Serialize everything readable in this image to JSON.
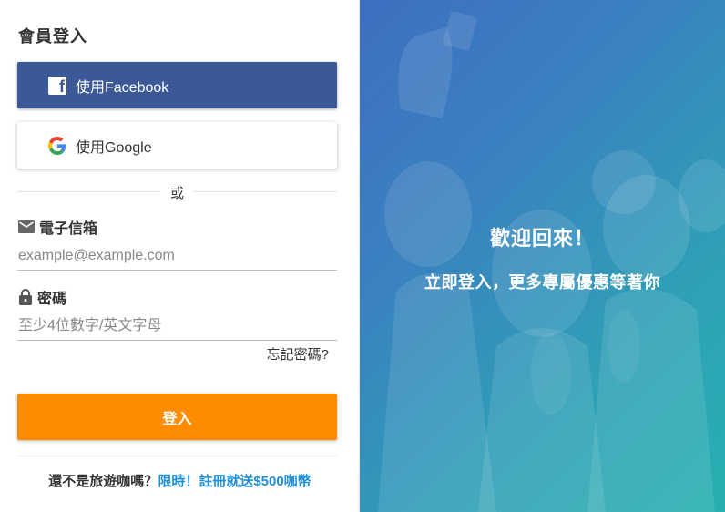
{
  "login": {
    "title": "會員登入",
    "facebook_label": "使用Facebook",
    "google_label": "使用Google",
    "divider_text": "或",
    "email_label": "電子信箱",
    "email_placeholder": "example@example.com",
    "password_label": "密碼",
    "password_placeholder": "至少4位數字/英文字母",
    "forgot_label": "忘記密碼?",
    "login_button": "登入",
    "signup_prompt": "還不是旅遊咖嗎？",
    "signup_link": "限時！註冊就送$500咖幣"
  },
  "promo": {
    "welcome": "歡迎回來！",
    "subtitle": "立即登入，更多專屬優惠等著你"
  },
  "colors": {
    "facebook": "#3b5897",
    "login_button": "#ff8b00",
    "link": "#1e8fd8"
  },
  "icons": [
    "facebook-icon",
    "google-icon",
    "mail-icon",
    "lock-icon"
  ]
}
